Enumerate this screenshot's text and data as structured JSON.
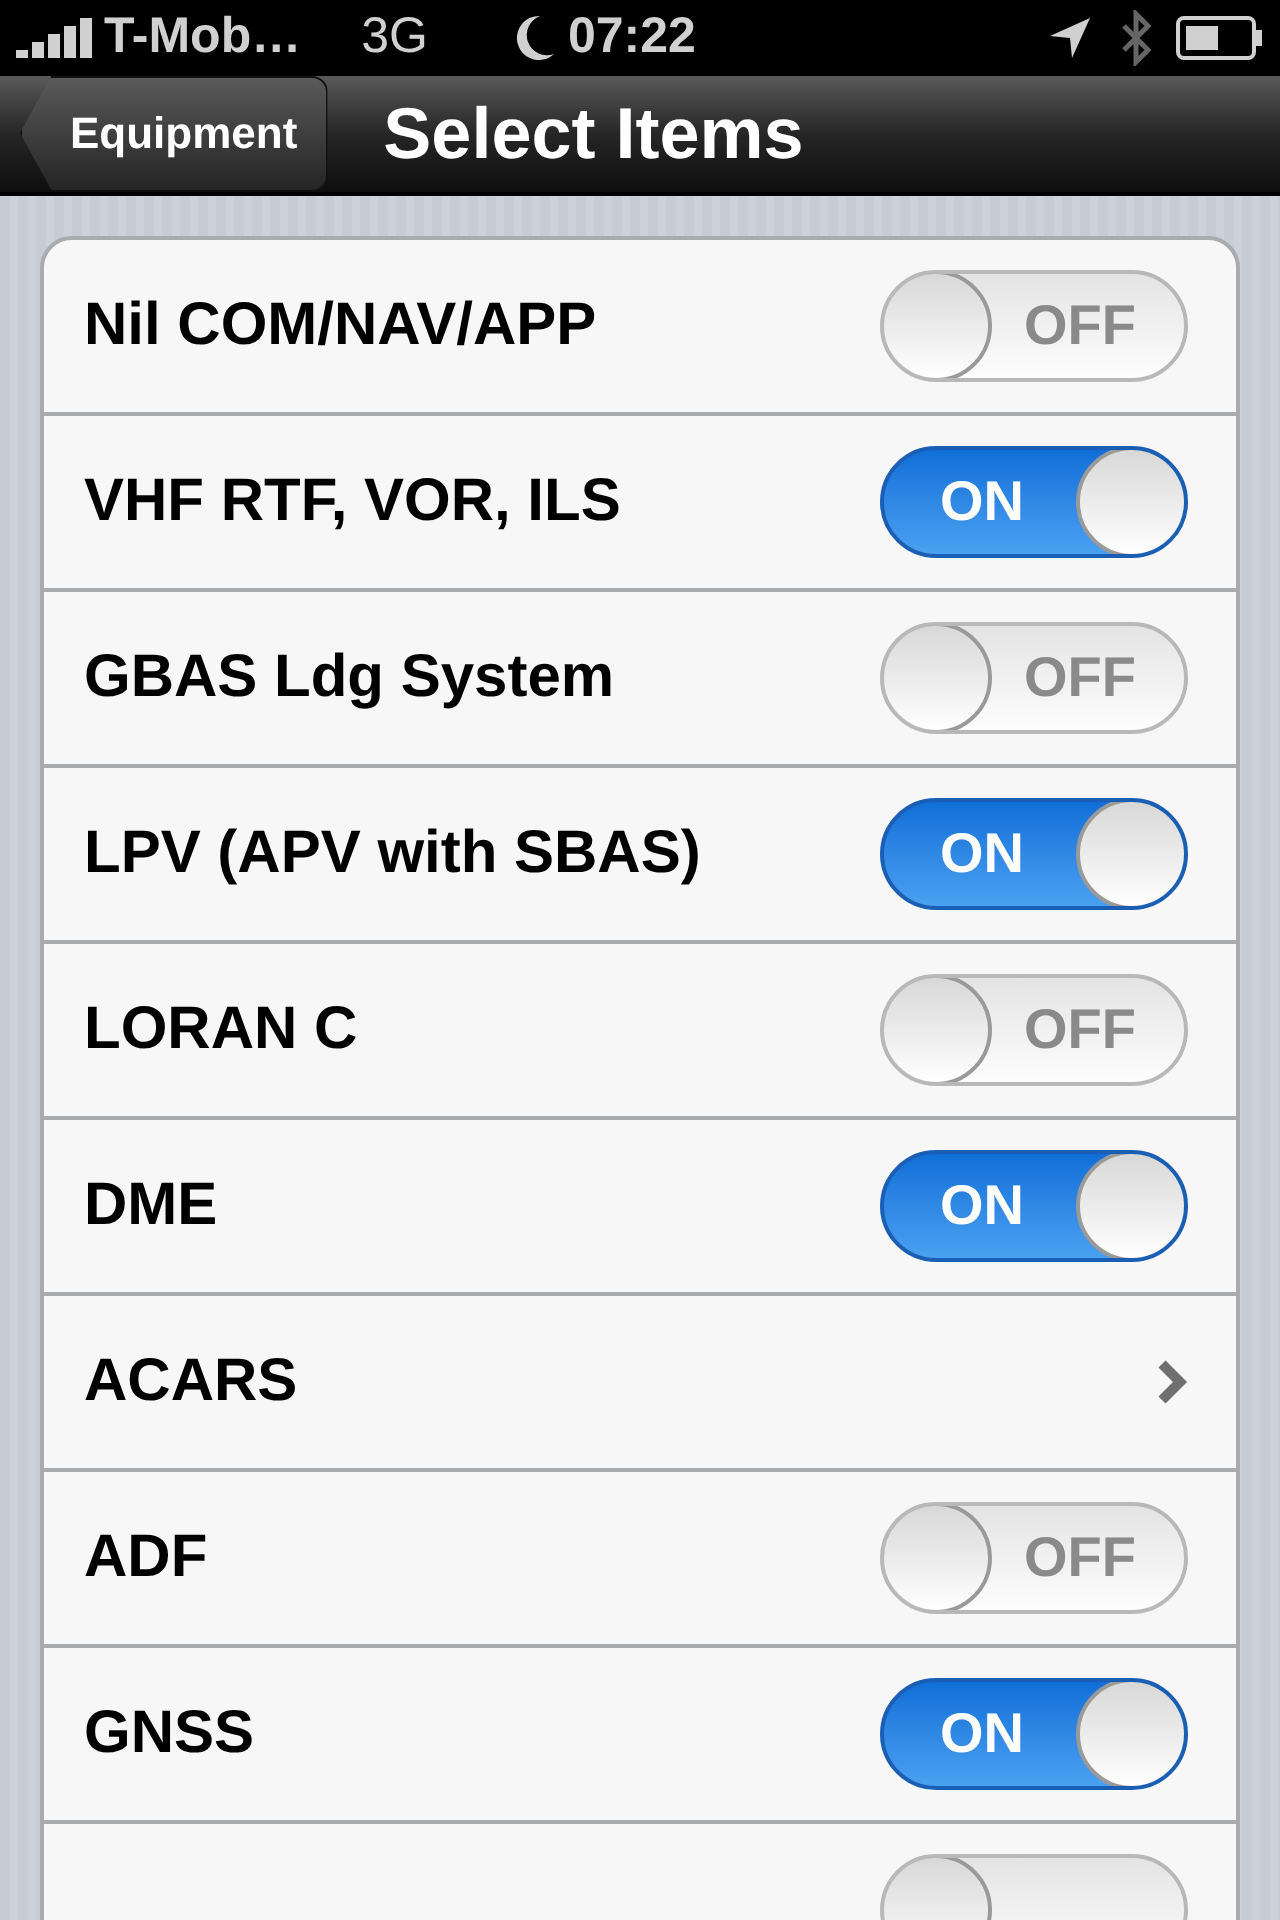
{
  "status_bar": {
    "carrier": "T-Mob…",
    "network": "3G",
    "time": "07:22"
  },
  "nav_bar": {
    "back": "Equipment",
    "title": "Select Items"
  },
  "items": [
    {
      "kind": "switch",
      "label": "Nil COM/NAV/APP",
      "on": false,
      "switch_text": "OFF"
    },
    {
      "kind": "switch",
      "label": "VHF RTF, VOR, ILS",
      "on": true,
      "switch_text": "ON"
    },
    {
      "kind": "switch",
      "label": "GBAS Ldg System",
      "on": false,
      "switch_text": "OFF"
    },
    {
      "kind": "switch",
      "label": "LPV (APV with SBAS)",
      "on": true,
      "switch_text": "ON"
    },
    {
      "kind": "switch",
      "label": "LORAN C",
      "on": false,
      "switch_text": "OFF"
    },
    {
      "kind": "switch",
      "label": "DME",
      "on": true,
      "switch_text": "ON"
    },
    {
      "kind": "link",
      "label": "ACARS"
    },
    {
      "kind": "switch",
      "label": "ADF",
      "on": false,
      "switch_text": "OFF"
    },
    {
      "kind": "switch",
      "label": "GNSS",
      "on": true,
      "switch_text": "ON"
    },
    {
      "kind": "switch",
      "on": false
    }
  ]
}
